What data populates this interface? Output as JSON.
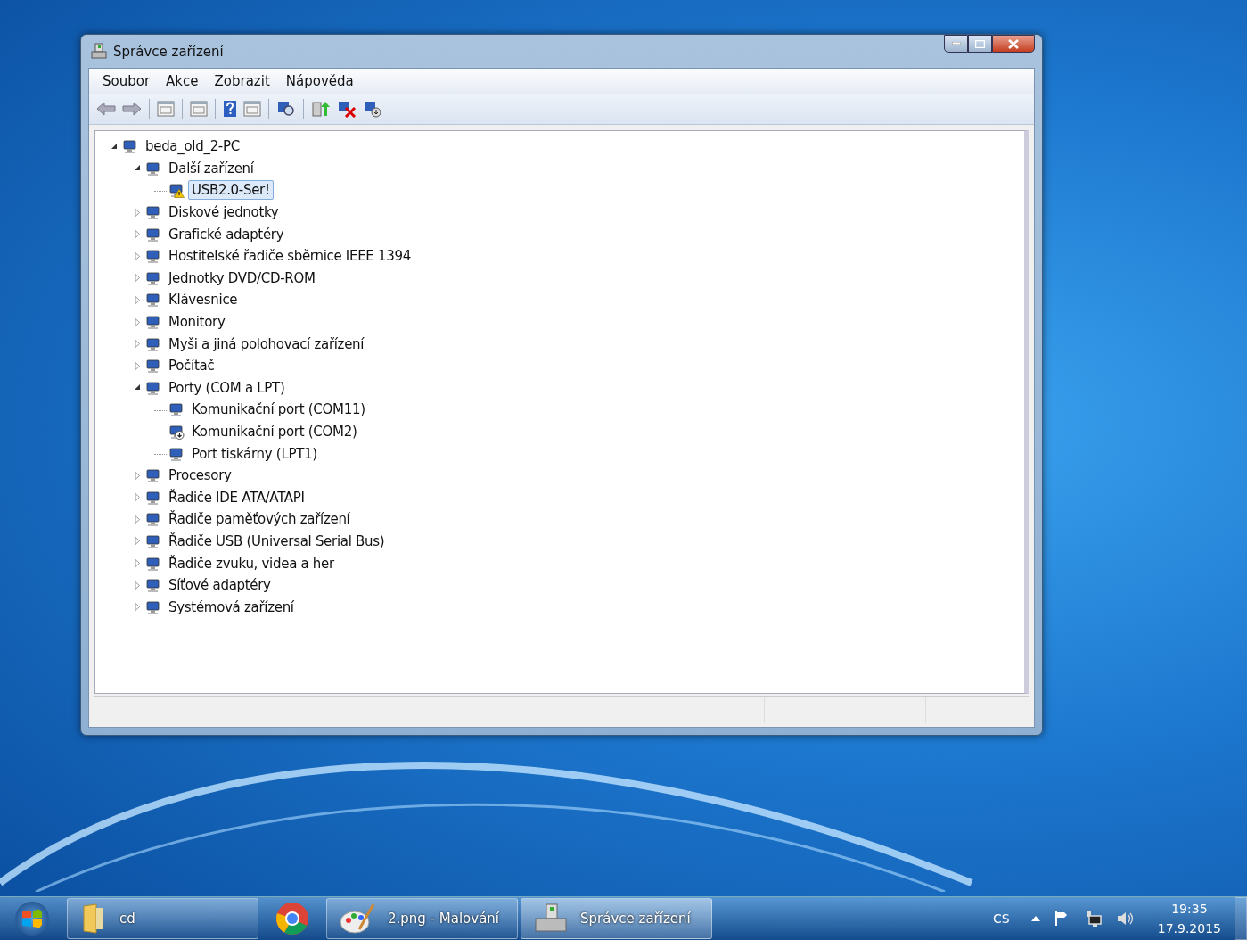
{
  "window": {
    "title": "Správce zařízení"
  },
  "menu": [
    "Soubor",
    "Akce",
    "Zobrazit",
    "Nápověda"
  ],
  "tree": [
    {
      "label": "beda_old_2-PC",
      "expanded": true,
      "selected": false,
      "warning": false,
      "disabled": false,
      "children": [
        {
          "label": "Další zařízení",
          "expanded": true,
          "selected": false,
          "warning": false,
          "disabled": false,
          "children": [
            {
              "label": "USB2.0-Ser!",
              "selected": true,
              "warning": true,
              "disabled": false
            }
          ]
        },
        {
          "label": "Diskové jednotky",
          "expanded": false,
          "selected": false,
          "warning": false,
          "disabled": false
        },
        {
          "label": "Grafické adaptéry",
          "expanded": false,
          "selected": false,
          "warning": false,
          "disabled": false
        },
        {
          "label": "Hostitelské řadiče sběrnice IEEE 1394",
          "expanded": false,
          "selected": false,
          "warning": false,
          "disabled": false
        },
        {
          "label": "Jednotky DVD/CD-ROM",
          "expanded": false,
          "selected": false,
          "warning": false,
          "disabled": false
        },
        {
          "label": "Klávesnice",
          "expanded": false,
          "selected": false,
          "warning": false,
          "disabled": false
        },
        {
          "label": "Monitory",
          "expanded": false,
          "selected": false,
          "warning": false,
          "disabled": false
        },
        {
          "label": "Myši a jiná polohovací zařízení",
          "expanded": false,
          "selected": false,
          "warning": false,
          "disabled": false
        },
        {
          "label": "Počítač",
          "expanded": false,
          "selected": false,
          "warning": false,
          "disabled": false
        },
        {
          "label": "Porty (COM a LPT)",
          "expanded": true,
          "selected": false,
          "warning": false,
          "disabled": false,
          "children": [
            {
              "label": "Komunikační port (COM11)",
              "selected": false,
              "warning": false,
              "disabled": false
            },
            {
              "label": "Komunikační port (COM2)",
              "selected": false,
              "warning": false,
              "disabled": true
            },
            {
              "label": "Port tiskárny (LPT1)",
              "selected": false,
              "warning": false,
              "disabled": false
            }
          ]
        },
        {
          "label": "Procesory",
          "expanded": false,
          "selected": false,
          "warning": false,
          "disabled": false
        },
        {
          "label": "Řadiče IDE ATA/ATAPI",
          "expanded": false,
          "selected": false,
          "warning": false,
          "disabled": false
        },
        {
          "label": "Řadiče paměťových zařízení",
          "expanded": false,
          "selected": false,
          "warning": false,
          "disabled": false
        },
        {
          "label": "Řadiče USB (Universal Serial Bus)",
          "expanded": false,
          "selected": false,
          "warning": false,
          "disabled": false
        },
        {
          "label": "Řadiče zvuku, videa a her",
          "expanded": false,
          "selected": false,
          "warning": false,
          "disabled": false
        },
        {
          "label": "Síťové adaptéry",
          "expanded": false,
          "selected": false,
          "warning": false,
          "disabled": false
        },
        {
          "label": "Systémová zařízení",
          "expanded": false,
          "selected": false,
          "warning": false,
          "disabled": false
        }
      ]
    }
  ],
  "taskbar": {
    "items": [
      {
        "label": "cd",
        "kind": "folder",
        "selected": false
      },
      {
        "kind": "browser",
        "selected": false
      },
      {
        "label": "2.png - Malování",
        "kind": "paint",
        "selected": false
      },
      {
        "label": "Správce zařízení",
        "kind": "devices",
        "selected": true
      }
    ],
    "language": "CS",
    "time": "19:35",
    "date": "17.9.2015"
  }
}
